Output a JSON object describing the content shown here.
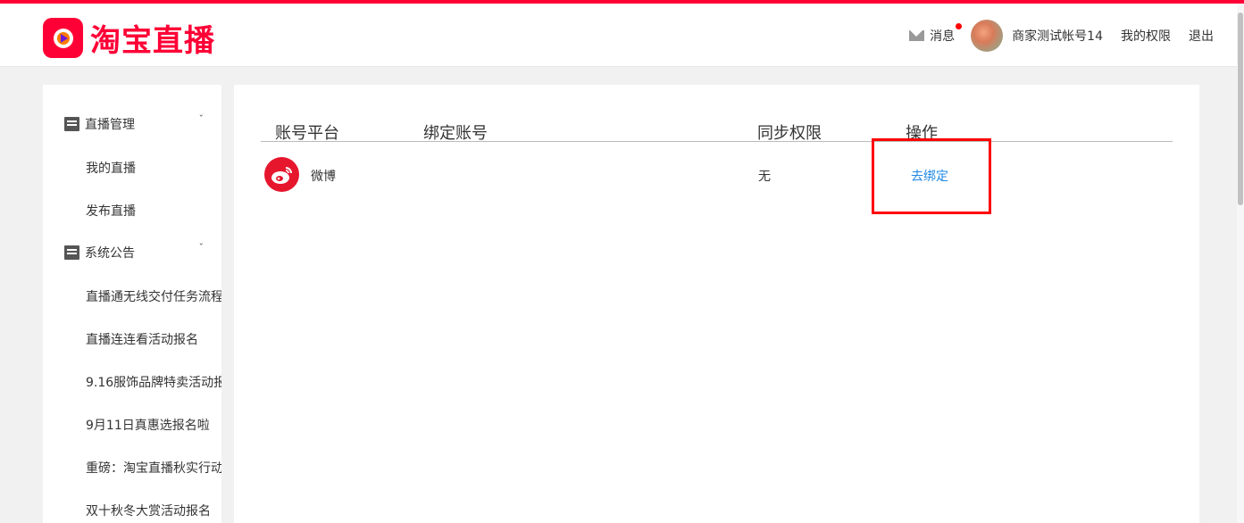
{
  "header": {
    "logo_text": "淘宝直播",
    "messages_label": "消息",
    "username": "商家测试帐号14",
    "permissions_label": "我的权限",
    "logout_label": "退出"
  },
  "sidebar": {
    "groups": [
      {
        "label": "直播管理",
        "items": [
          "我的直播",
          "发布直播"
        ]
      },
      {
        "label": "系统公告",
        "items": [
          "直播通无线交付任务流程",
          "直播连连看活动报名",
          "9.16服饰品牌特卖活动报",
          "9月11日真惠选报名啦",
          "重磅：淘宝直播秋实行动",
          "双十秋冬大赏活动报名"
        ]
      }
    ]
  },
  "table": {
    "headers": [
      "账号平台",
      "绑定账号",
      "同步权限",
      "操作"
    ],
    "rows": [
      {
        "platform": "微博",
        "account": "",
        "permission": "无",
        "action": "去绑定"
      }
    ]
  },
  "colors": {
    "brand": "#ff0036",
    "link": "#1e88e5",
    "highlight": "#ff0000"
  }
}
